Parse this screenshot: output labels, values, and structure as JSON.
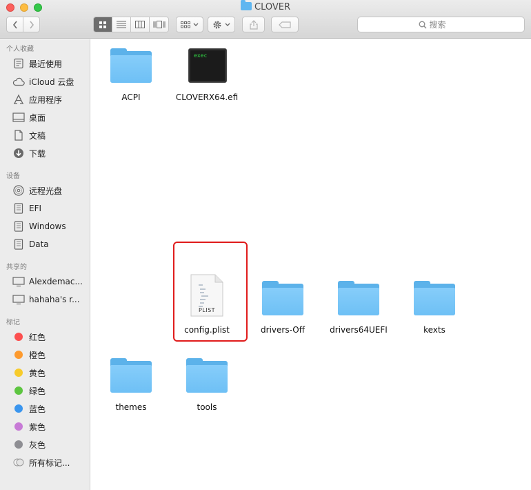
{
  "window": {
    "title": "CLOVER"
  },
  "toolbar": {
    "search_placeholder": "搜索"
  },
  "sidebar": {
    "sections": [
      {
        "title": "个人收藏",
        "items": [
          {
            "label": "最近使用",
            "icon": "recents-icon"
          },
          {
            "label": "iCloud 云盘",
            "icon": "cloud-icon"
          },
          {
            "label": "应用程序",
            "icon": "applications-icon"
          },
          {
            "label": "桌面",
            "icon": "desktop-icon"
          },
          {
            "label": "文稿",
            "icon": "documents-icon"
          },
          {
            "label": "下载",
            "icon": "downloads-icon"
          }
        ]
      },
      {
        "title": "设备",
        "items": [
          {
            "label": "远程光盘",
            "icon": "disc-icon"
          },
          {
            "label": "EFI",
            "icon": "disk-icon"
          },
          {
            "label": "Windows",
            "icon": "disk-icon"
          },
          {
            "label": "Data",
            "icon": "disk-icon"
          }
        ]
      },
      {
        "title": "共享的",
        "items": [
          {
            "label": "Alexdemac...",
            "icon": "computer-icon"
          },
          {
            "label": "hahaha's r...",
            "icon": "computer-icon"
          }
        ]
      },
      {
        "title": "标记",
        "items": [
          {
            "label": "红色",
            "color": "#fc4f4f"
          },
          {
            "label": "橙色",
            "color": "#fd9a2e"
          },
          {
            "label": "黄色",
            "color": "#f7cb2b"
          },
          {
            "label": "绿色",
            "color": "#5dc540"
          },
          {
            "label": "蓝色",
            "color": "#3a95ee"
          },
          {
            "label": "紫色",
            "color": "#c77ad6"
          },
          {
            "label": "灰色",
            "color": "#8e8e93"
          },
          {
            "label": "所有标记...",
            "color": ""
          }
        ]
      }
    ]
  },
  "files": [
    {
      "name": "ACPI",
      "kind": "folder"
    },
    {
      "name": "CLOVERX64.efi",
      "kind": "exec",
      "badge": "exec"
    },
    {
      "name": "config.plist",
      "kind": "plist",
      "badge": "PLIST",
      "highlighted": true
    },
    {
      "name": "drivers-Off",
      "kind": "folder"
    },
    {
      "name": "drivers64UEFI",
      "kind": "folder"
    },
    {
      "name": "kexts",
      "kind": "folder"
    },
    {
      "name": "themes",
      "kind": "folder"
    },
    {
      "name": "tools",
      "kind": "folder"
    }
  ],
  "colors": {
    "highlight": "#e01b1b",
    "folder": "#6ec0f5"
  }
}
